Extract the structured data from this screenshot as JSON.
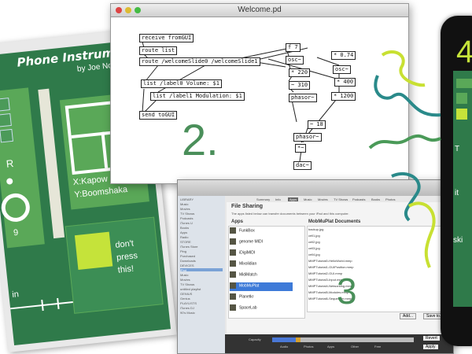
{
  "left_panel": {
    "title": "Phone Instrument!",
    "author": "by Joe NonCoder",
    "letter_r": "R",
    "xy_x": "X:Kapow",
    "xy_y": "Y:Boomshaka",
    "number_9": "9",
    "in_label": "in",
    "dont_press": [
      "don't",
      "press",
      "this!"
    ]
  },
  "pd_window": {
    "title": "Welcome.pd",
    "step_label": "2.",
    "objects": [
      "receive fromGUI",
      "route list",
      "route /welcomeSlide0 /welcomeSlide1",
      "list /label0 Volume: $1",
      "list /label1 Modulation: $1",
      "send toGUI",
      "f 7",
      "osc~",
      "* 220",
      "~ 310",
      "phasor~",
      "* 0.74",
      "osc~",
      "* 400",
      "* 1200",
      "~ 18",
      "phasor~",
      "*~",
      "dac~"
    ]
  },
  "itunes_window": {
    "step_label": "3",
    "section_title": "File Sharing",
    "section_desc": "The apps listed below can transfer documents between your iPad and this computer.",
    "tabs": [
      "Summary",
      "Info",
      "Apps",
      "Music",
      "Movies",
      "TV Shows",
      "Podcasts",
      "Books",
      "Photos"
    ],
    "sidebar": [
      "LIBRARY",
      "Music",
      "Movies",
      "TV Shows",
      "Podcasts",
      "iTunes U",
      "Books",
      "Apps",
      "Radio",
      "STORE",
      "iTunes Store",
      "Ping",
      "Purchased",
      "Downloads",
      "DEVICES",
      "iPad",
      "Music",
      "Movies",
      "TV Shows",
      "untitled playlist",
      "GENIUS",
      "Genius",
      "PLAYLISTS",
      "iTunes DJ",
      "90's Music"
    ],
    "apps_header": "Apps",
    "apps": [
      "FunkBox",
      "genome MIDI",
      "iDigiMIDI",
      "Mixolidian",
      "MidiMatch",
      "MobMuPlat",
      "Planetkr",
      "SpaceLab"
    ],
    "docs_header": "MobMuPlat Documents",
    "docs": [
      "backup.jpg",
      "cell1.jpg",
      "cell2.jpg",
      "cell3.jpg",
      "cell4.jpg",
      "MMPTutorial0-HelloWorld.mmp",
      "MMPTutorial1-GUIPosition.mmp",
      "MMPTutorial2-GUI.mmp",
      "MMPTutorial3-Input.mmp",
      "MMPTutorial4-Networking.mmp",
      "MMPTutorial5-Modules.mmp",
      "MMPTutorial6-Sequencer.mmp"
    ],
    "add_button": "Add...",
    "save_button": "Save to...",
    "capacity_label": "Capacity",
    "legend": [
      "Audio",
      "Photos",
      "Apps",
      "Other",
      "Free"
    ],
    "revert_button": "Revert",
    "apply_button": "Apply"
  },
  "phone": {
    "step_label": "4",
    "labels": [
      "T",
      "it",
      "ski"
    ]
  },
  "colors": {
    "panel_green": "#2f7a4a",
    "light_green": "#5aa858",
    "lime": "#c5e33a",
    "scribble_teal": "#2a8a8a",
    "scribble_lime": "#c8e032"
  }
}
